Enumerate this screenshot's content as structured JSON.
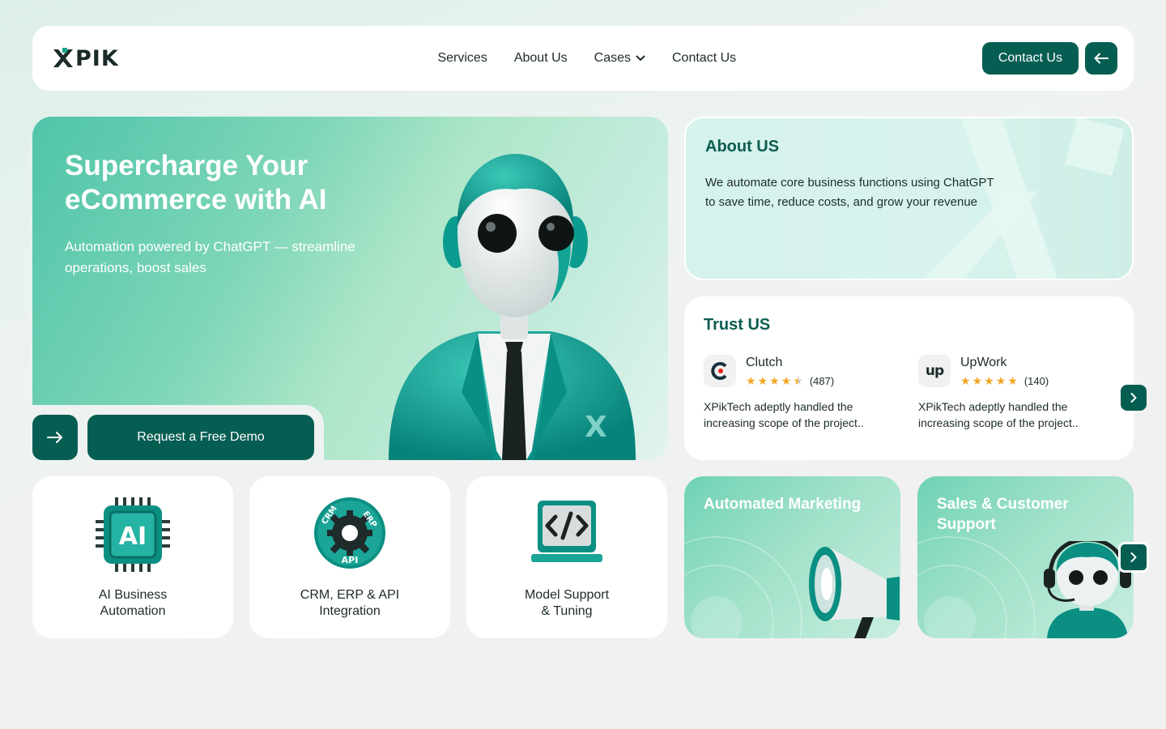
{
  "brand": {
    "logo_text": "PIK",
    "accent": "#065e52",
    "icon": "x-logo-icon"
  },
  "nav": {
    "links": [
      "Services",
      "About Us",
      "Cases",
      "Contact Us"
    ],
    "cases_dropdown_icon": "chevron-down-icon",
    "cta_label": "Contact Us",
    "back_icon": "arrow-left-icon"
  },
  "hero": {
    "title": "Supercharge Your eCommerce with AI",
    "subtitle": "Automation powered by ChatGPT — streamline operations, boost sales",
    "demo_label": "Request a Free Demo",
    "arrow_icon": "arrow-right-icon",
    "illustration": "robot-in-suit-illustration"
  },
  "about": {
    "title": "About US",
    "text": "We automate core business functions using ChatGPT to save time, reduce costs, and grow your revenue"
  },
  "trust": {
    "title": "Trust US",
    "reviews": [
      {
        "platform": "Clutch",
        "rating": 4.5,
        "count": "(487)",
        "text": "XPikTech adeptly handled the increasing scope of the project..",
        "icon": "clutch-logo-icon"
      },
      {
        "platform": "UpWork",
        "rating": 5,
        "count": "(140)",
        "text": "XPikTech adeptly handled the increasing scope of the project..",
        "icon": "upwork-logo-icon"
      }
    ],
    "next_icon": "chevron-right-icon",
    "star_color": "#f4a623"
  },
  "services": [
    {
      "label_line1": "AI Business",
      "label_line2": "Automation",
      "icon": "ai-chip-icon"
    },
    {
      "label_line1": "CRM, ERP & API",
      "label_line2": "Integration",
      "icon": "gear-integration-icon"
    },
    {
      "label_line1": "Model Support",
      "label_line2": "& Tuning",
      "icon": "code-laptop-icon"
    }
  ],
  "features": [
    {
      "title": "Automated Marketing",
      "icon": "megaphone-icon"
    },
    {
      "title": "Sales & Customer Support",
      "icon": "support-robot-icon"
    }
  ],
  "features_next_icon": "chevron-right-icon"
}
